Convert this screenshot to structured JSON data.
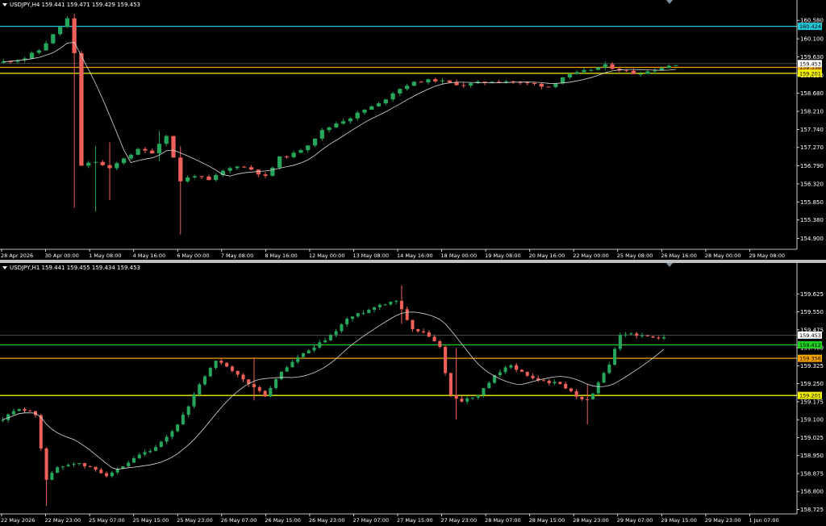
{
  "colors": {
    "background": "#000000",
    "bull": "#26a65b",
    "bear": "#f0605a",
    "ma": "#d8d8d8",
    "axis": "#ffffff",
    "cyan": "#22c8d8",
    "orange": "#f4a300",
    "yellow": "#f0f000",
    "green": "#1fd21f"
  },
  "top_chart": {
    "header": "USDJPY,H4  159.441 159.471 159.429 159.453",
    "icon": "chevron-down-icon"
  },
  "bottom_chart": {
    "header": "USDJPY,H1  159.441 159.455 159.434 159.453",
    "icon": "chevron-down-icon"
  },
  "chart_data": [
    {
      "type": "candlestick",
      "symbol": "USDJPY",
      "timeframe": "H4",
      "ylim": [
        154.7,
        160.9
      ],
      "y_ticks": [
        "160.580",
        "160.100",
        "159.630",
        "159.150",
        "158.680",
        "158.210",
        "157.740",
        "157.270",
        "156.790",
        "156.320",
        "155.850",
        "155.380",
        "154.900"
      ],
      "x_ticks": [
        "28 Apr 2026",
        "30 Apr 00:00",
        "1 May 08:00",
        "4 May 16:00",
        "6 May 00:00",
        "7 May 08:00",
        "8 May 16:00",
        "12 May 00:00",
        "13 May 08:00",
        "14 May 16:00",
        "18 May 00:00",
        "19 May 08:00",
        "20 May 16:00",
        "22 May 00:00",
        "25 May 08:00",
        "26 May 16:00",
        "28 May 00:00",
        "29 May 08:00"
      ],
      "levels": [
        {
          "value": 160.424,
          "label": "160.424",
          "color": "#22c8d8"
        },
        {
          "value": 159.356,
          "label": "159.356",
          "color": "#f4a300"
        },
        {
          "value": 159.201,
          "label": "159.201",
          "color": "#f0f000"
        }
      ],
      "current_price": {
        "value": 159.453,
        "label": "159.453"
      },
      "anchors": [
        [
          0,
          159.5
        ],
        [
          3,
          159.6
        ],
        [
          5,
          159.8
        ],
        [
          7,
          160.2
        ],
        [
          9,
          160.62
        ],
        [
          10,
          159.7
        ],
        [
          11,
          156.8
        ],
        [
          13,
          156.9
        ],
        [
          15,
          156.7
        ],
        [
          17,
          157.0
        ],
        [
          19,
          157.2
        ],
        [
          21,
          157.15
        ],
        [
          23,
          157.6
        ],
        [
          25,
          156.4
        ],
        [
          27,
          156.55
        ],
        [
          29,
          156.4
        ],
        [
          31,
          156.65
        ],
        [
          33,
          156.8
        ],
        [
          35,
          156.7
        ],
        [
          37,
          156.5
        ],
        [
          39,
          157.0
        ],
        [
          41,
          157.1
        ],
        [
          43,
          157.35
        ],
        [
          45,
          157.7
        ],
        [
          47,
          157.9
        ],
        [
          49,
          158.05
        ],
        [
          51,
          158.25
        ],
        [
          53,
          158.4
        ],
        [
          55,
          158.7
        ],
        [
          57,
          158.9
        ],
        [
          59,
          159.0
        ],
        [
          61,
          159.02
        ],
        [
          63,
          158.95
        ],
        [
          65,
          158.9
        ],
        [
          67,
          158.95
        ],
        [
          69,
          159.0
        ],
        [
          71,
          159.0
        ],
        [
          73,
          158.95
        ],
        [
          75,
          158.92
        ],
        [
          77,
          158.85
        ],
        [
          79,
          159.1
        ],
        [
          81,
          159.2
        ],
        [
          83,
          159.3
        ],
        [
          85,
          159.4
        ],
        [
          87,
          159.3
        ],
        [
          89,
          159.2
        ],
        [
          91,
          159.25
        ],
        [
          93,
          159.35
        ],
        [
          95,
          159.45
        ]
      ],
      "spikes": [
        {
          "i": 10,
          "high": 160.75,
          "low": 155.7
        },
        {
          "i": 13,
          "high": 157.3,
          "low": 155.6
        },
        {
          "i": 25,
          "high": 157.3,
          "low": 155.0
        },
        {
          "i": 22,
          "high": 157.7,
          "low": 156.9
        },
        {
          "i": 15,
          "high": 157.4,
          "low": 155.9
        }
      ],
      "ma_period": 8
    },
    {
      "type": "candlestick",
      "symbol": "USDJPY",
      "timeframe": "H1",
      "ylim": [
        158.72,
        159.7
      ],
      "y_ticks": [
        "159.625",
        "159.550",
        "159.475",
        "159.400",
        "159.325",
        "159.250",
        "159.175",
        "159.100",
        "159.025",
        "158.950",
        "158.875",
        "158.800",
        "158.725"
      ],
      "x_ticks": [
        "22 May 2026",
        "22 May 23:00",
        "25 May 07:00",
        "25 May 15:00",
        "25 May 23:00",
        "26 May 07:00",
        "26 May 15:00",
        "26 May 23:00",
        "27 May 07:00",
        "27 May 15:00",
        "27 May 23:00",
        "28 May 07:00",
        "28 May 15:00",
        "28 May 23:00",
        "29 May 07:00",
        "29 May 15:00",
        "29 May 23:00",
        "1 Jun 07:00"
      ],
      "levels": [
        {
          "value": 159.412,
          "label": "159.412",
          "color": "#1fd21f"
        },
        {
          "value": 159.356,
          "label": "159.356",
          "color": "#f4a300"
        },
        {
          "value": 159.201,
          "label": "159.201",
          "color": "#f0f000"
        }
      ],
      "current_price": {
        "value": 159.453,
        "label": "159.453"
      },
      "anchors": [
        [
          0,
          159.1
        ],
        [
          3,
          159.15
        ],
        [
          6,
          159.12
        ],
        [
          8,
          158.85
        ],
        [
          10,
          158.9
        ],
        [
          13,
          158.92
        ],
        [
          16,
          158.9
        ],
        [
          19,
          158.87
        ],
        [
          22,
          158.9
        ],
        [
          25,
          158.95
        ],
        [
          28,
          158.98
        ],
        [
          31,
          159.05
        ],
        [
          34,
          159.15
        ],
        [
          36,
          159.25
        ],
        [
          39,
          159.35
        ],
        [
          42,
          159.3
        ],
        [
          45,
          159.25
        ],
        [
          48,
          159.2
        ],
        [
          51,
          159.3
        ],
        [
          54,
          159.36
        ],
        [
          57,
          159.4
        ],
        [
          60,
          159.45
        ],
        [
          63,
          159.52
        ],
        [
          66,
          159.55
        ],
        [
          69,
          159.58
        ],
        [
          72,
          159.6
        ],
        [
          75,
          159.48
        ],
        [
          78,
          159.45
        ],
        [
          80,
          159.4
        ],
        [
          82,
          159.2
        ],
        [
          84,
          159.18
        ],
        [
          87,
          159.2
        ],
        [
          90,
          159.28
        ],
        [
          93,
          159.33
        ],
        [
          96,
          159.28
        ],
        [
          99,
          159.26
        ],
        [
          102,
          159.25
        ],
        [
          105,
          159.2
        ],
        [
          107,
          159.18
        ],
        [
          109,
          159.25
        ],
        [
          111,
          159.33
        ],
        [
          113,
          159.45
        ],
        [
          115,
          159.46
        ],
        [
          117,
          159.45
        ],
        [
          119,
          159.44
        ],
        [
          121,
          159.45
        ]
      ],
      "spikes": [
        {
          "i": 8,
          "high": 158.95,
          "low": 158.74
        },
        {
          "i": 46,
          "high": 159.36,
          "low": 159.18
        },
        {
          "i": 83,
          "high": 159.4,
          "low": 159.1
        },
        {
          "i": 107,
          "high": 159.25,
          "low": 159.08
        },
        {
          "i": 73,
          "high": 159.66,
          "low": 159.5
        }
      ],
      "ma_period": 14
    }
  ]
}
